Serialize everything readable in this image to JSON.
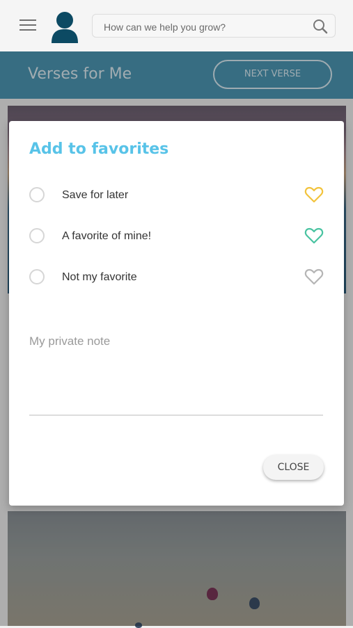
{
  "header": {
    "menu_icon": "hamburger-menu-icon",
    "avatar_icon": "user-avatar-icon",
    "search": {
      "placeholder": "How can we help you grow?",
      "icon": "search-icon"
    }
  },
  "hero": {
    "title": "Verses for Me",
    "next_button": "NEXT VERSE"
  },
  "dialog": {
    "title": "Add to favorites",
    "options": [
      {
        "label": "Save for later",
        "icon": "heart-outline-icon",
        "color": "#f2c33c"
      },
      {
        "label": "A favorite of mine!",
        "icon": "heart-outline-icon",
        "color": "#49c3a1"
      },
      {
        "label": "Not my favorite",
        "icon": "heart-outline-icon",
        "color": "#b5b5b5"
      }
    ],
    "note_placeholder": "My private note",
    "close_button": "CLOSE"
  },
  "colors": {
    "accent": "#58c3e8",
    "hero_bar": "#4d97b4"
  }
}
